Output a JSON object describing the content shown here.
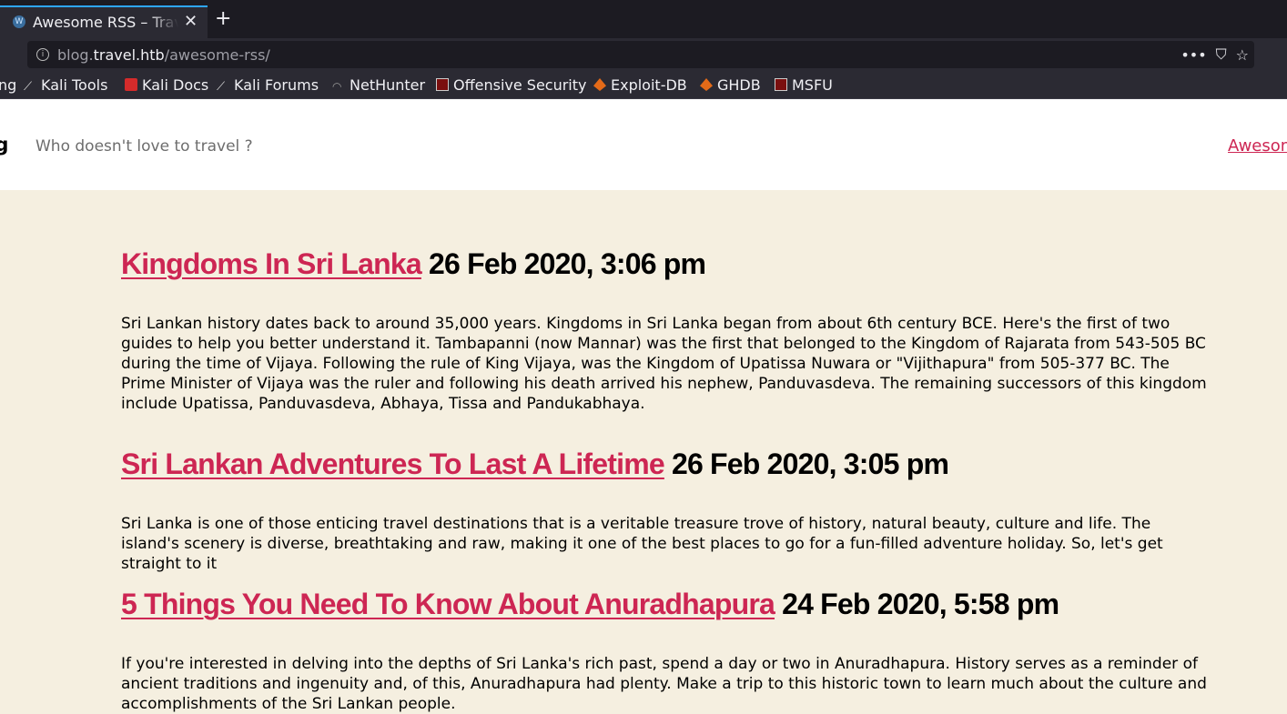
{
  "browser": {
    "tab_title": "Awesome RSS – Travel Blog",
    "new_tab_label": "+",
    "close_label": "✕",
    "url_sub": "blog.",
    "url_domain": "travel.htb",
    "url_path": "/awesome-rss/",
    "actions": [
      "•••",
      "⛉",
      "☆"
    ],
    "bookmarks": [
      {
        "label": "ng",
        "icon": "none"
      },
      {
        "label": "Kali Tools",
        "icon": "kali-dragon-icon"
      },
      {
        "label": "Kali Docs",
        "icon": "kali-docs-icon"
      },
      {
        "label": "Kali Forums",
        "icon": "kali-dragon-icon"
      },
      {
        "label": "NetHunter",
        "icon": "nethunter-icon"
      },
      {
        "label": "Offensive Security",
        "icon": "offsec-icon"
      },
      {
        "label": "Exploit-DB",
        "icon": "exploitdb-icon"
      },
      {
        "label": "GHDB",
        "icon": "exploitdb-icon"
      },
      {
        "label": "MSFU",
        "icon": "offsec-icon"
      }
    ]
  },
  "site": {
    "title": "og",
    "description": "Who doesn't love to travel ?",
    "nav_link": "Awesome RSS",
    "accent": "#cd2653",
    "background": "#f5efe0"
  },
  "posts": [
    {
      "title": "Kingdoms In Sri Lanka",
      "date": "26 Feb 2020, 3:06 pm",
      "excerpt": "Sri Lankan history dates back to around 35,000 years. Kingdoms in Sri Lanka began from about 6th century BCE. Here's the first of two guides to help you better understand it. Tambapanni (now Mannar) was the first that belonged to the Kingdom of Rajarata from 543-505 BC during the time of Vijaya. Following the rule of King Vijaya, was the Kingdom of Upatissa Nuwara or \"Vijithapura\" from 505-377 BC. The Prime Minister of Vijaya was the ruler and following his death arrived his nephew, Panduvasdeva. The remaining successors of this kingdom include Upatissa, Panduvasdeva, Abhaya, Tissa and Pandukabhaya."
    },
    {
      "title": "Sri Lankan Adventures To Last A Lifetime",
      "date": "26 Feb 2020, 3:05 pm",
      "excerpt": "Sri Lanka is one of those enticing travel destinations that is a veritable treasure trove of history, natural beauty, culture and life. The island's scenery is diverse, breathtaking and raw, making it one of the best places to go for a fun-filled adventure holiday. So, let's get straight to it"
    },
    {
      "title": "5 Things You Need To Know About Anuradhapura",
      "date": "24 Feb 2020, 5:58 pm",
      "excerpt": "If you're interested in delving into the depths of Sri Lanka's rich past, spend a day or two in Anuradhapura. History serves as a reminder of ancient traditions and ingenuity and, of this, Anuradhapura had plenty. Make a trip to this historic town to learn much about the culture and accomplishments of the Sri Lankan people."
    }
  ]
}
